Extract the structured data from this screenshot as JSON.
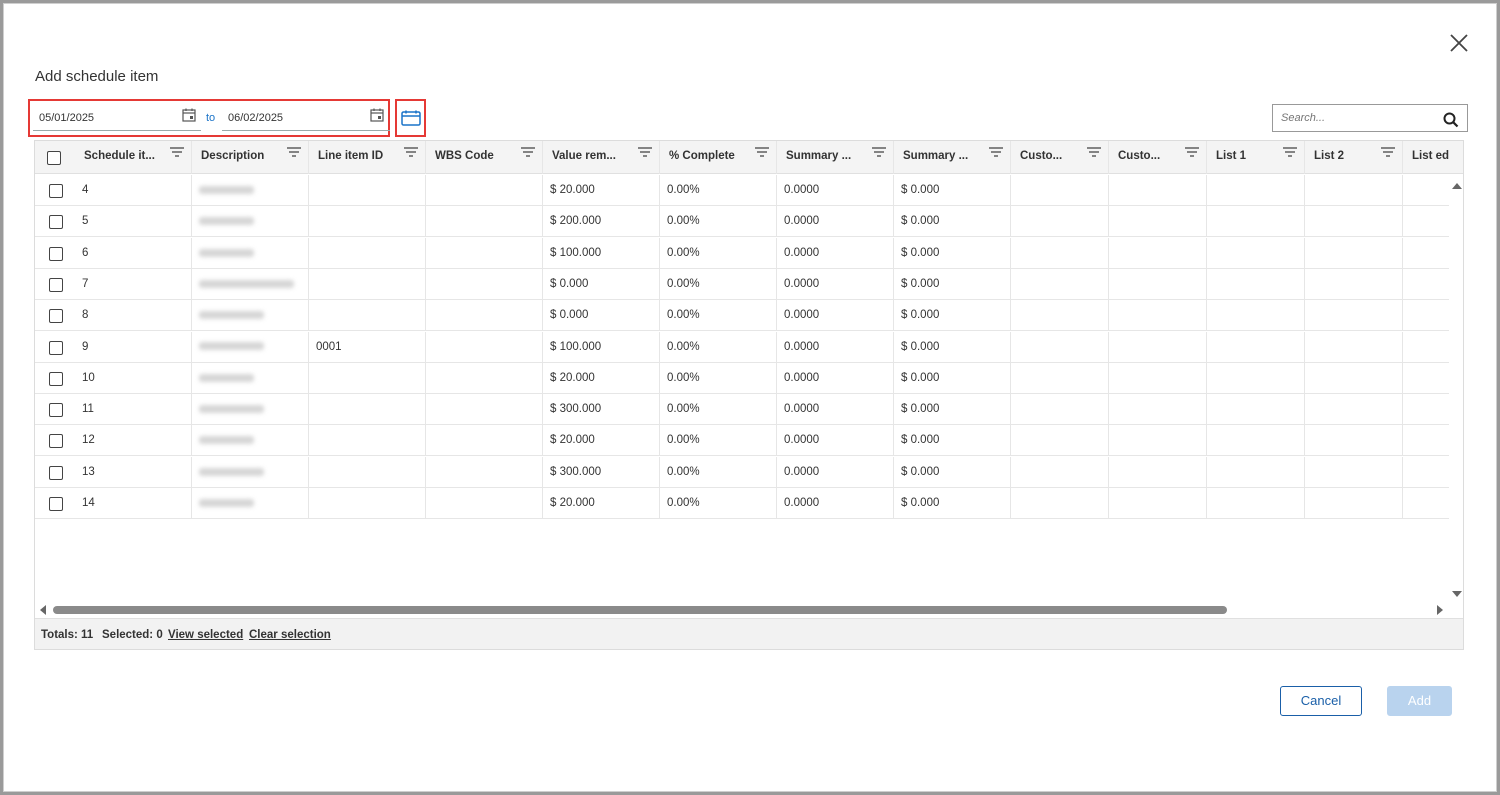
{
  "dialog": {
    "title": "Add schedule item"
  },
  "date_range": {
    "start": "05/01/2025",
    "to_label": "to",
    "end": "06/02/2025"
  },
  "search": {
    "placeholder": "Search..."
  },
  "grid": {
    "columns": [
      "Schedule it...",
      "Description",
      "Line item ID",
      "WBS Code",
      "Value rem...",
      "% Complete",
      "Summary ...",
      "Summary ...",
      "Custo...",
      "Custo...",
      "List 1",
      "List 2",
      "List ed"
    ],
    "rows": [
      {
        "id": "4",
        "line_item": "",
        "value": "$ 20.000",
        "pct": "0.00%",
        "sum1": "0.0000",
        "sum2": "$ 0.000"
      },
      {
        "id": "5",
        "line_item": "",
        "value": "$ 200.000",
        "pct": "0.00%",
        "sum1": "0.0000",
        "sum2": "$ 0.000"
      },
      {
        "id": "6",
        "line_item": "",
        "value": "$ 100.000",
        "pct": "0.00%",
        "sum1": "0.0000",
        "sum2": "$ 0.000"
      },
      {
        "id": "7",
        "line_item": "",
        "value": "$ 0.000",
        "pct": "0.00%",
        "sum1": "0.0000",
        "sum2": "$ 0.000"
      },
      {
        "id": "8",
        "line_item": "",
        "value": "$ 0.000",
        "pct": "0.00%",
        "sum1": "0.0000",
        "sum2": "$ 0.000"
      },
      {
        "id": "9",
        "line_item": "0001",
        "value": "$ 100.000",
        "pct": "0.00%",
        "sum1": "0.0000",
        "sum2": "$ 0.000"
      },
      {
        "id": "10",
        "line_item": "",
        "value": "$ 20.000",
        "pct": "0.00%",
        "sum1": "0.0000",
        "sum2": "$ 0.000"
      },
      {
        "id": "11",
        "line_item": "",
        "value": "$ 300.000",
        "pct": "0.00%",
        "sum1": "0.0000",
        "sum2": "$ 0.000"
      },
      {
        "id": "12",
        "line_item": "",
        "value": "$ 20.000",
        "pct": "0.00%",
        "sum1": "0.0000",
        "sum2": "$ 0.000"
      },
      {
        "id": "13",
        "line_item": "",
        "value": "$ 300.000",
        "pct": "0.00%",
        "sum1": "0.0000",
        "sum2": "$ 0.000"
      },
      {
        "id": "14",
        "line_item": "",
        "value": "$ 20.000",
        "pct": "0.00%",
        "sum1": "0.0000",
        "sum2": "$ 0.000"
      }
    ]
  },
  "footer": {
    "totals": "Totals: 11",
    "selected": "Selected: 0",
    "view_selected": "View selected",
    "clear_selection": "Clear selection"
  },
  "buttons": {
    "cancel": "Cancel",
    "add": "Add"
  },
  "colors": {
    "accent": "#1a5fa8",
    "highlight": "#e53935",
    "disabled_button": "#b9d3ee"
  },
  "icons": [
    "close-icon",
    "calendar-icon",
    "date-range-icon",
    "search-icon",
    "filter-icon"
  ]
}
